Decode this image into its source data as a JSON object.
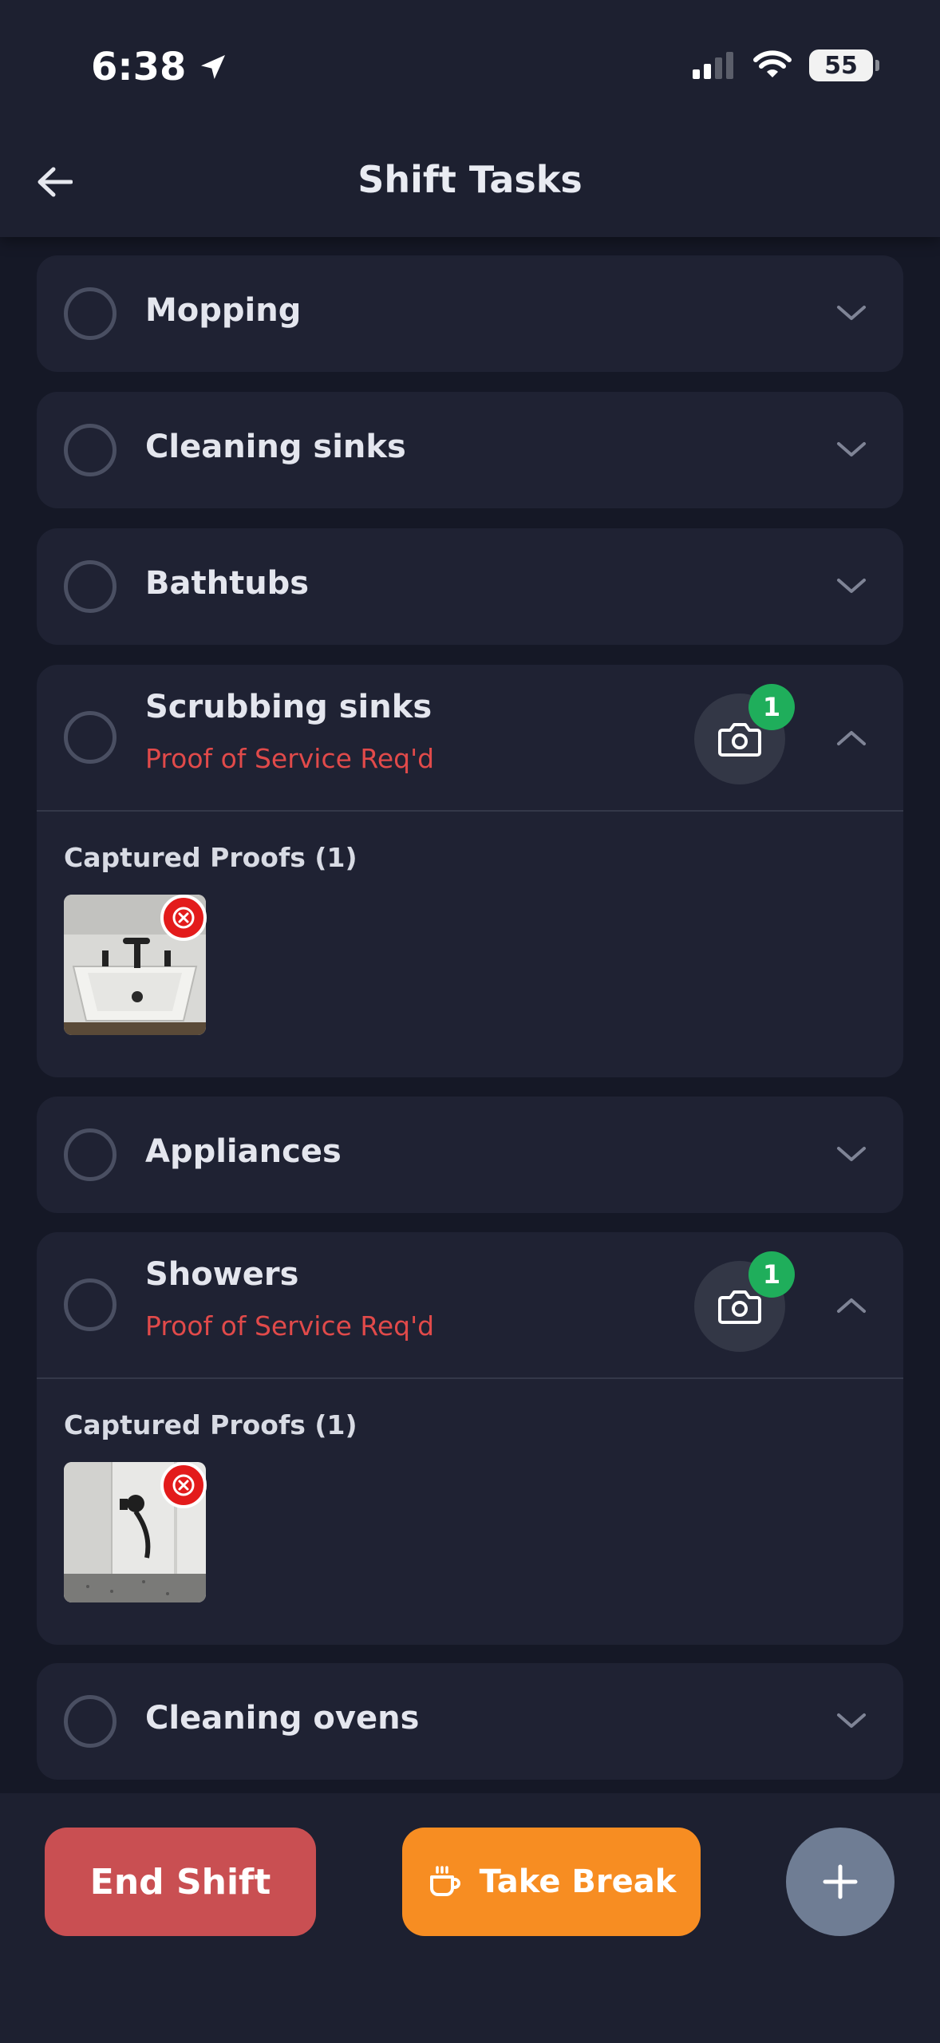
{
  "status_bar": {
    "time": "6:38",
    "battery": "55"
  },
  "header": {
    "title": "Shift Tasks"
  },
  "tasks": [
    {
      "title": "Mopping"
    },
    {
      "title": "Cleaning sinks"
    },
    {
      "title": "Bathtubs"
    },
    {
      "title": "Scrubbing sinks",
      "requirement": "Proof of Service Req'd",
      "proof_count": "1",
      "proofs_label": "Captured Proofs (1)"
    },
    {
      "title": "Appliances"
    },
    {
      "title": "Showers",
      "requirement": "Proof of Service Req'd",
      "proof_count": "1",
      "proofs_label": "Captured Proofs (1)"
    },
    {
      "title": "Cleaning ovens"
    }
  ],
  "actions": {
    "end_shift": "End Shift",
    "take_break": "Take Break"
  },
  "colors": {
    "background": "#151826",
    "card": "#1f2233",
    "requirement_text": "#e14a4a",
    "badge": "#1fae5b",
    "end_shift": "#c94f52",
    "take_break": "#f78d22",
    "add_button": "#6f7d94"
  },
  "icons": [
    "location-arrow-icon",
    "signal-icon",
    "wifi-icon",
    "battery-icon",
    "back-arrow-icon",
    "chevron-down-icon",
    "chevron-up-icon",
    "camera-icon",
    "remove-icon",
    "coffee-icon",
    "plus-icon"
  ]
}
